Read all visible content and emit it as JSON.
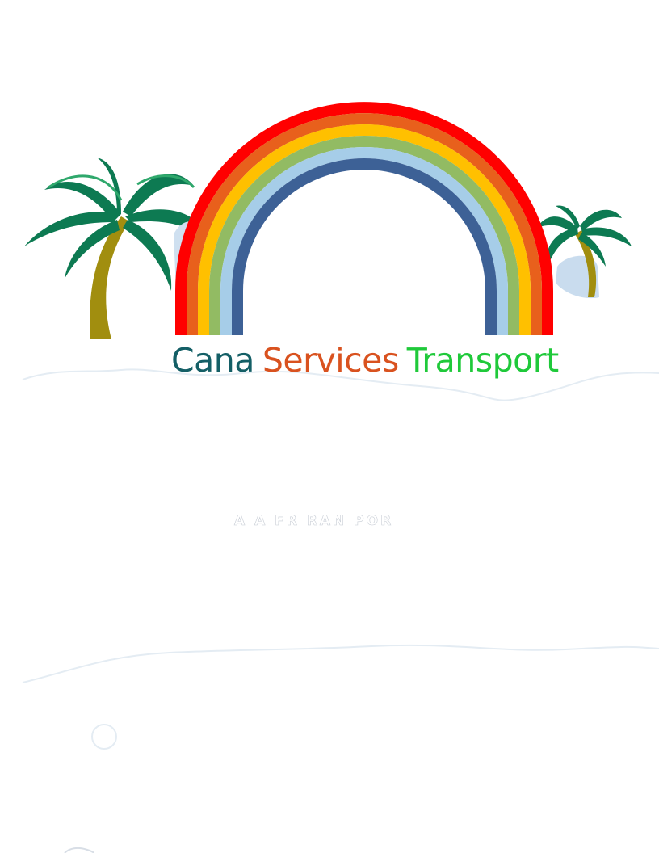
{
  "brand": {
    "word1": "Cana",
    "word2": "Services",
    "word3": "Transport",
    "colors": {
      "word1": "#145f66",
      "word2": "#d9521f",
      "word3": "#1fc93a"
    }
  },
  "faint_text": "A A FR RAN POR",
  "rainbow_colors": [
    "#ff0000",
    "#e8601c",
    "#ffc000",
    "#92bb63",
    "#a6cde8",
    "#3d6196"
  ],
  "icons": [
    "palm-tree-left-icon",
    "palm-tree-right-icon",
    "rainbow-icon"
  ]
}
